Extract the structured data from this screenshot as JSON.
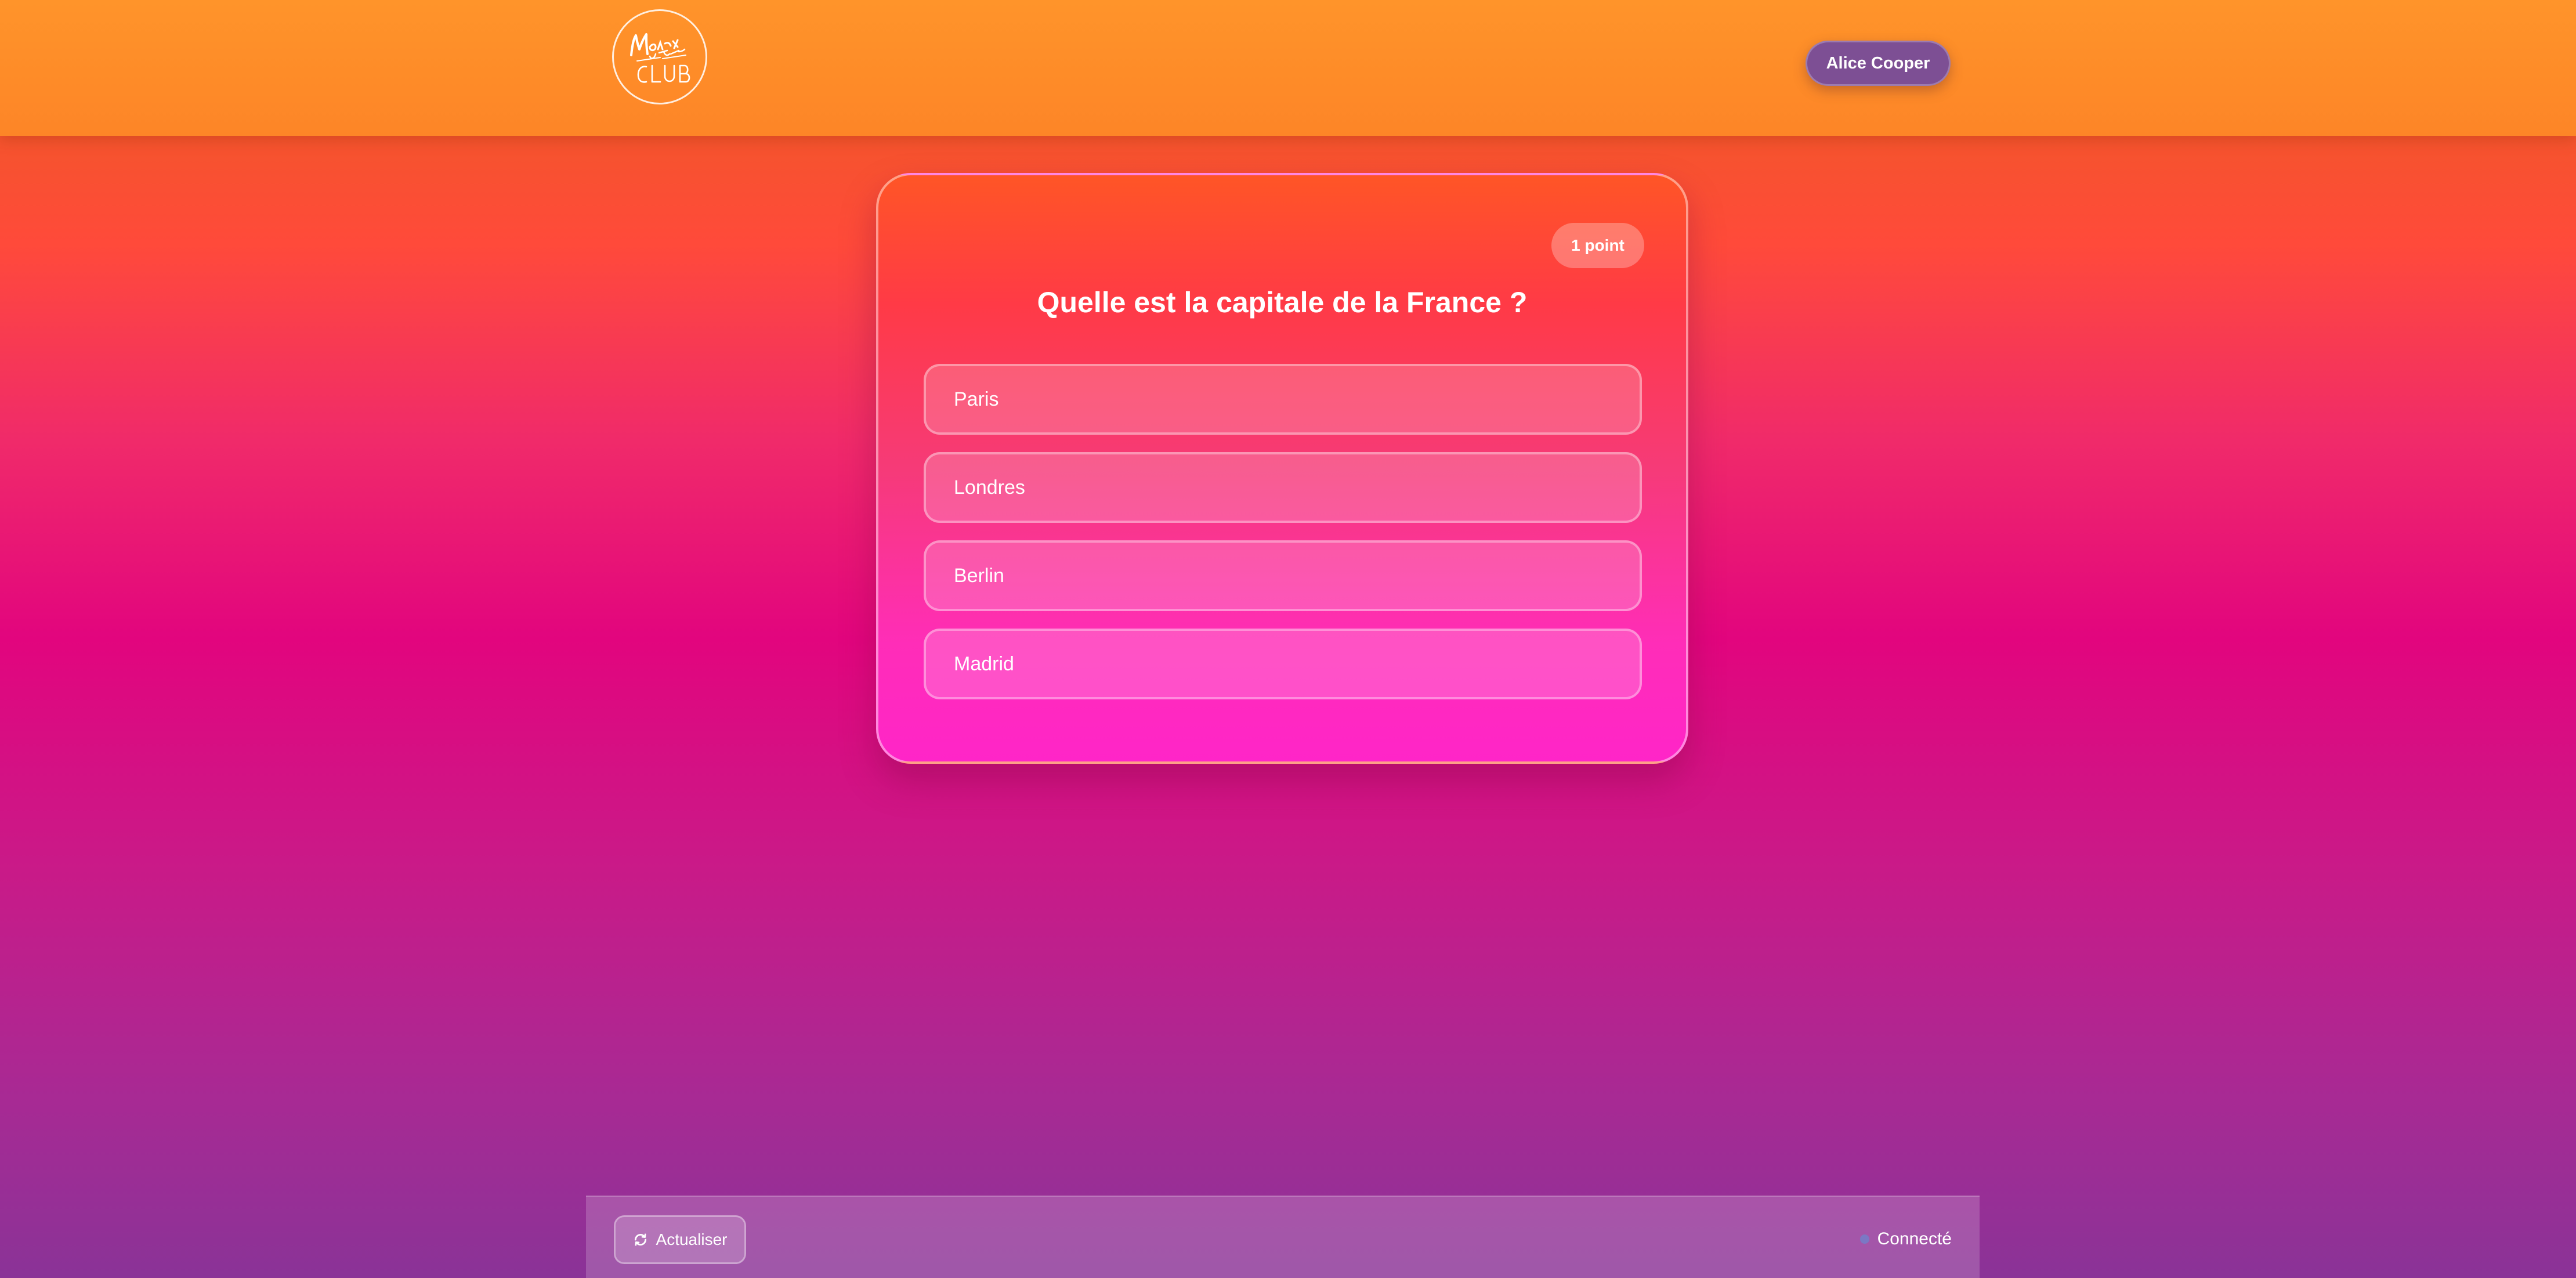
{
  "header": {
    "logo_text": "Montreux Jazz Club",
    "user_name": "Alice Cooper"
  },
  "question_card": {
    "points": "1 point",
    "question": "Quelle est la capitale de la France ?",
    "answers": [
      "Paris",
      "Londres",
      "Berlin",
      "Madrid"
    ]
  },
  "footer": {
    "refresh_label": "Actualiser",
    "status_label": "Connecté",
    "refresh_icon": "refresh-icon"
  },
  "colors": {
    "header_orange": "#ff942a",
    "user_pill": "#7d4f94",
    "card_top": "#ff5526",
    "card_bottom": "#ff25c8",
    "status_dot": "#7b78c4"
  }
}
